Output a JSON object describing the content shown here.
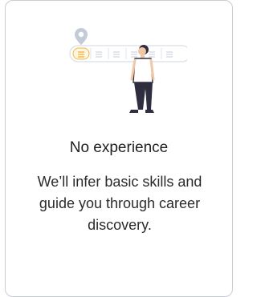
{
  "card": {
    "title": "No experience",
    "description": "We’ll infer basic skills and guide you through career discovery.",
    "accent_color": "#f4b63f",
    "pin_color": "#c3cbd9",
    "border_color": "#c9ccd3"
  },
  "illustration": {
    "icon": "person-with-roadmap-illustration"
  }
}
